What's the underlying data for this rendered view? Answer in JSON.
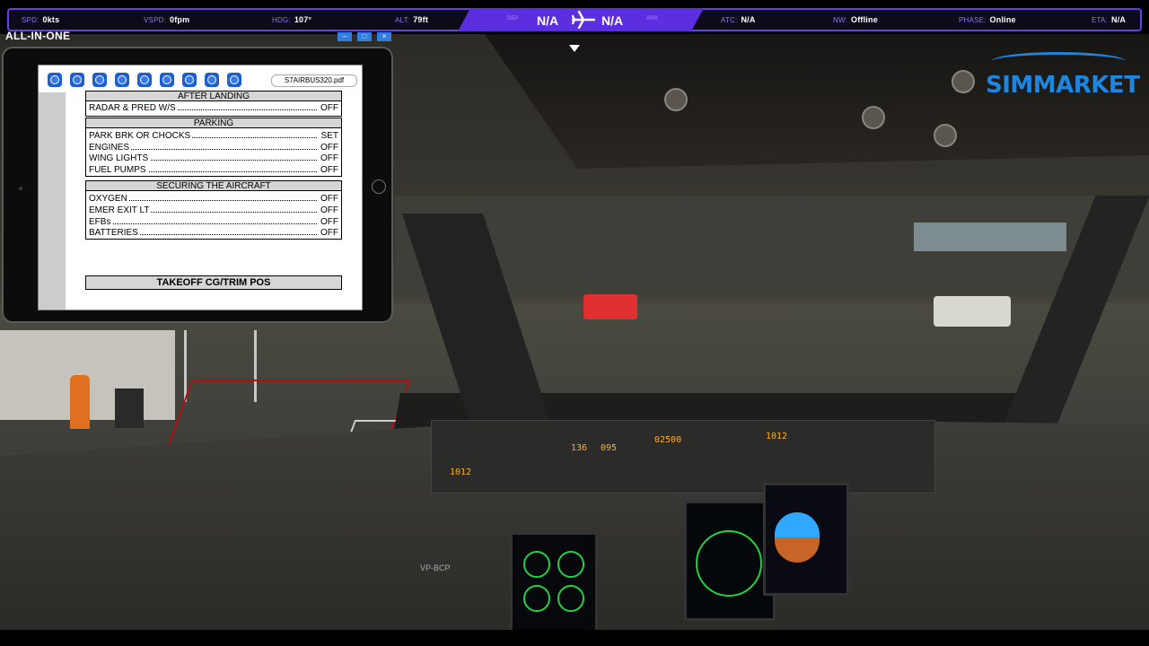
{
  "topbar": {
    "spd_label": "SPD:",
    "spd_value": "0kts",
    "vspd_label": "VSPD:",
    "vspd_value": "0fpm",
    "hdg_label": "HDG:",
    "hdg_value": "107°",
    "alt_label": "ALT:",
    "alt_value": "79ft",
    "dep_value": "N/A",
    "arr_value": "N/A",
    "dep_label": "DEP",
    "arr_label": "ARR",
    "atc_label": "ATC:",
    "atc_value": "N/A",
    "nw_label": "NW:",
    "nw_value": "Offline",
    "phase_label": "PHASE:",
    "phase_value": "Online",
    "eta_label": "ETA:",
    "eta_value": "N/A",
    "accent_color": "#6a3cf0"
  },
  "aio": {
    "title": "ALL-IN-ONE",
    "controls": [
      "minimize-icon",
      "maximize-icon",
      "close-icon"
    ]
  },
  "tablet": {
    "filename": "S7AIRBUS320.pdf",
    "toolbar_icons": [
      "first-page-icon",
      "zoom-fit-icon",
      "menu-icon",
      "page-icon",
      "rotate-icon",
      "previous-page-icon",
      "next-page-icon",
      "zoom-in-icon",
      "zoom-out-icon"
    ],
    "doc": {
      "after_landing": {
        "title": "AFTER LANDING",
        "items": [
          {
            "item": "RADAR & PRED W/S",
            "value": "OFF"
          }
        ]
      },
      "parking": {
        "title": "PARKING",
        "items": [
          {
            "item": "PARK BRK OR CHOCKS",
            "value": "SET"
          },
          {
            "item": "ENGINES",
            "value": "OFF"
          },
          {
            "item": "WING LIGHTS",
            "value": "OFF"
          },
          {
            "item": "FUEL PUMPS",
            "value": "OFF"
          }
        ]
      },
      "securing": {
        "title": "SECURING THE AIRCRAFT",
        "items": [
          {
            "item": "OXYGEN",
            "value": "OFF"
          },
          {
            "item": "EMER EXIT LT",
            "value": "OFF"
          },
          {
            "item": "EFBs",
            "value": "OFF"
          },
          {
            "item": "BATTERIES",
            "value": "OFF"
          }
        ]
      },
      "takeoff": "TAKEOFF CG/TRIM POS"
    }
  },
  "cockpit": {
    "fcu_spd": "136",
    "fcu_hdg": "095",
    "fcu_alt": "02500",
    "baro_left": "1012",
    "baro_right": "1012",
    "registration": "VP-BCP"
  },
  "logo": {
    "text": "SIMMARKET",
    "color": "#1c86e0"
  }
}
